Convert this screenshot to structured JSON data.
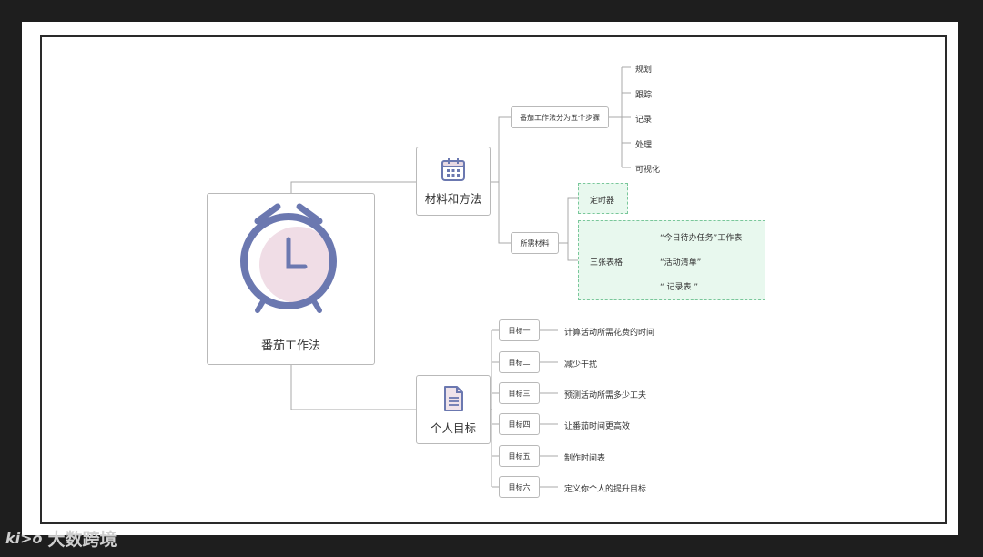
{
  "central": {
    "title": "番茄工作法"
  },
  "branch_materials": {
    "title": "材料和方法",
    "steps": {
      "title": "番茄工作法分为五个步骤",
      "items": [
        "规划",
        "跟踪",
        "记录",
        "处理",
        "可视化"
      ]
    },
    "required": {
      "title": "所需材料",
      "timer": "定时器",
      "forms": {
        "title": "三张表格",
        "items": [
          "“今日待办任务”工作表",
          "“活动清单”",
          "“ 记录表 ”"
        ]
      }
    }
  },
  "branch_goals": {
    "title": "个人目标",
    "goals": [
      {
        "label": "目标一",
        "text": "计算活动所需花费的时间"
      },
      {
        "label": "目标二",
        "text": "减少干扰"
      },
      {
        "label": "目标三",
        "text": "预测活动所需多少工夫"
      },
      {
        "label": "目标四",
        "text": "让番茄时间更高效"
      },
      {
        "label": "目标五",
        "text": "制作时间表"
      },
      {
        "label": "目标六",
        "text": "定义你个人的提升目标"
      }
    ]
  },
  "watermark": {
    "logo": "ki>o",
    "text": "大数跨境"
  },
  "colors": {
    "icon": "#6b78b0",
    "icon_bg": "#f0dde6",
    "dashed_fill": "#e8f8ee",
    "dashed_border": "#79c79a",
    "line": "#a9a9a9"
  }
}
